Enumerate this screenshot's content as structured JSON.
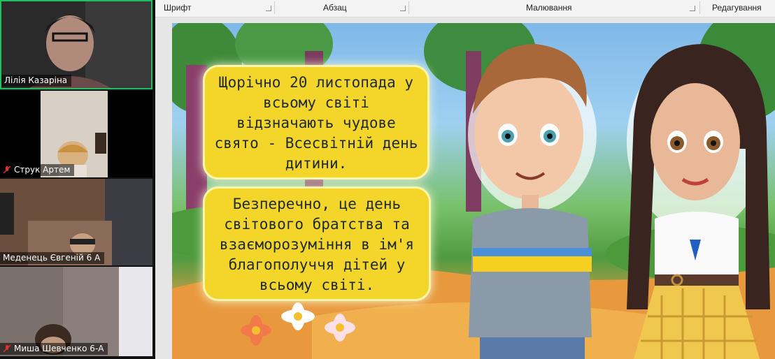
{
  "participants": [
    {
      "name": "Лілія Казаріна",
      "muted": false
    },
    {
      "name": "Струк Артем",
      "muted": true
    },
    {
      "name": "Меденець Євгеній 6 А",
      "muted": false
    },
    {
      "name": "Миша Шевченко 6-А",
      "muted": true
    }
  ],
  "ribbon": {
    "groups": [
      "Шрифт",
      "Абзац",
      "Малювання",
      "Редагування"
    ]
  },
  "slide": {
    "box1": "Щорічно 20 листопада у всьому світі відзначають чудове свято - Всесвітній день дитини.",
    "box2": "Безперечно, це день світового братства та взаєморозуміння в ім'я благополуччя дітей у всьому світі."
  },
  "colors": {
    "active_speaker_border": "#20c060",
    "textbox_fill": "#f4d62a",
    "shirt_blue": "#4a90d9",
    "shirt_yellow": "#f5d020"
  }
}
